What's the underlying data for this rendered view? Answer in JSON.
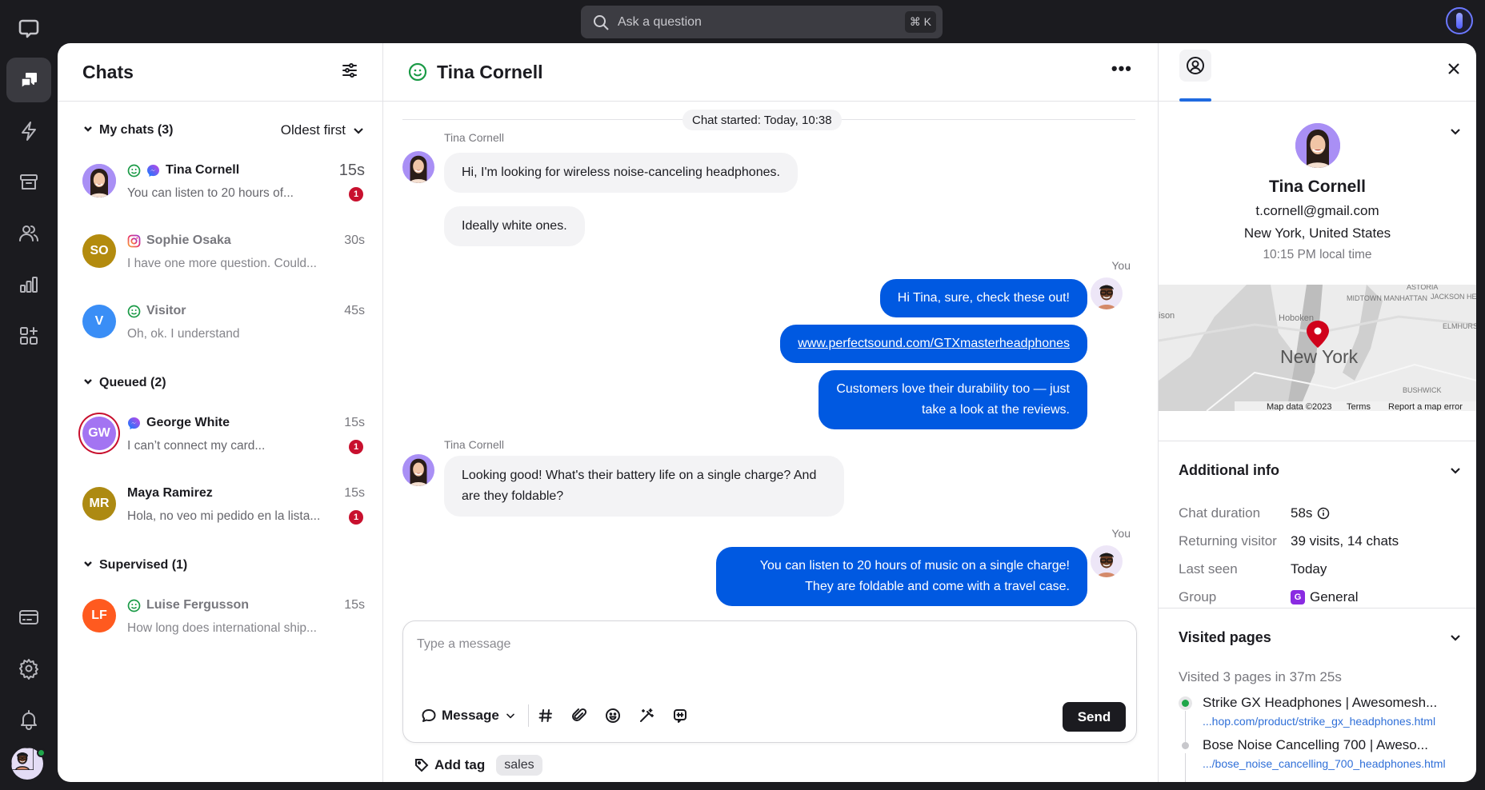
{
  "topbar": {
    "search_placeholder": "Ask a question",
    "search_shortcut": "⌘ K"
  },
  "rail": {
    "items": [
      {
        "icon": "logo-chat-icon"
      },
      {
        "icon": "chats-icon",
        "active": true
      },
      {
        "icon": "lightning-icon"
      },
      {
        "icon": "archive-icon"
      },
      {
        "icon": "customers-icon"
      },
      {
        "icon": "reports-icon"
      },
      {
        "icon": "apps-icon"
      },
      {
        "icon": "billing-icon"
      },
      {
        "icon": "settings-icon"
      },
      {
        "icon": "bell-icon"
      }
    ]
  },
  "chats": {
    "title": "Chats",
    "sections": [
      {
        "label": "My chats (3)",
        "sort": "Oldest first",
        "items": [
          {
            "name": "Tina Cornell",
            "message": "You can listen to 20 hours of...",
            "time": "15s",
            "unread": "1",
            "initials": "",
            "color": "#a98ff5",
            "channels": [
              "smiley",
              "messenger"
            ]
          },
          {
            "name": "Sophie Osaka",
            "message": "I have one more question. Could...",
            "time": "30s",
            "unread": "",
            "initials": "SO",
            "color": "#b38b0e",
            "channels": [
              "instagram"
            ]
          },
          {
            "name": "Visitor",
            "message": "Oh, ok. I understand",
            "time": "45s",
            "unread": "",
            "initials": "V",
            "color": "#3a8ef6",
            "channels": [
              "smiley"
            ]
          }
        ]
      },
      {
        "label": "Queued (2)",
        "items": [
          {
            "name": "George White",
            "message": "I can’t connect my card...",
            "time": "15s",
            "unread": "1",
            "initials": "GW",
            "color": "#a374f2",
            "channels": [
              "messenger"
            ]
          },
          {
            "name": "Maya Ramirez",
            "message": "Hola, no veo mi pedido en la lista...",
            "time": "15s",
            "unread": "1",
            "initials": "MR",
            "color": "#ad8a12",
            "channels": []
          }
        ]
      },
      {
        "label": "Supervised (1)",
        "items": [
          {
            "name": "Luise  Fergusson",
            "message": "How long does international ship...",
            "time": "15s",
            "unread": "",
            "initials": "LF",
            "color": "#ff5a1f",
            "channels": [
              "smiley"
            ]
          }
        ]
      }
    ]
  },
  "conversation": {
    "title": "Tina Cornell",
    "started": "Chat started: Today, 10:38",
    "messages": [
      {
        "sender": "Tina Cornell",
        "side": "in",
        "text": "Hi, I'm looking for wireless noise-canceling headphones."
      },
      {
        "sender": "",
        "side": "in",
        "text": "Ideally white ones."
      },
      {
        "sender": "You",
        "side": "out",
        "text": "Hi Tina, sure, check these out!"
      },
      {
        "sender": "",
        "side": "out",
        "text": "www.perfectsound.com/GTXmasterheadphones",
        "link": true
      },
      {
        "sender": "",
        "side": "out",
        "text": "Customers love their durability too — just take a look at the reviews."
      },
      {
        "sender": "Tina Cornell",
        "side": "in",
        "text": "Looking good! What's their battery life on a single charge? And are they foldable?"
      },
      {
        "sender": "You",
        "side": "out",
        "text": "You can listen to 20 hours of music on a single charge! They are foldable and come with a travel case."
      }
    ],
    "composer": {
      "placeholder": "Type a message",
      "mode": "Message",
      "send": "Send"
    },
    "add_tag": "Add tag",
    "tags": [
      "sales"
    ]
  },
  "details": {
    "name": "Tina Cornell",
    "email": "t.cornell@gmail.com",
    "location": "New York, United States",
    "local_time": "10:15 PM local time",
    "map": {
      "city": "New York",
      "labels": [
        "MIDTOWN MANHATTAN",
        "ASTORIA",
        "JACKSON HEIGHTS",
        "Hoboken",
        "ELMHURST",
        "BUSHWICK",
        "ison"
      ],
      "attribution": "Map data ©2023",
      "terms": "Terms",
      "report": "Report a map error"
    },
    "additional": {
      "title": "Additional info",
      "rows": [
        {
          "key": "Chat duration",
          "value": "58s"
        },
        {
          "key": "Returning visitor",
          "value": "39 visits, 14 chats"
        },
        {
          "key": "Last seen",
          "value": "Today"
        },
        {
          "key": "Group",
          "value": "General",
          "badge": "G"
        }
      ]
    },
    "visited": {
      "title": "Visited pages",
      "summary": "Visited 3 pages in 37m 25s",
      "pages": [
        {
          "title": "Strike GX Headphones | Awesomesh...",
          "url": "...hop.com/product/strike_gx_headphones.html",
          "current": true
        },
        {
          "title": "Bose Noise Cancelling 700 | Aweso...",
          "url": ".../bose_noise_cancelling_700_headphones.html",
          "current": false
        }
      ]
    }
  }
}
